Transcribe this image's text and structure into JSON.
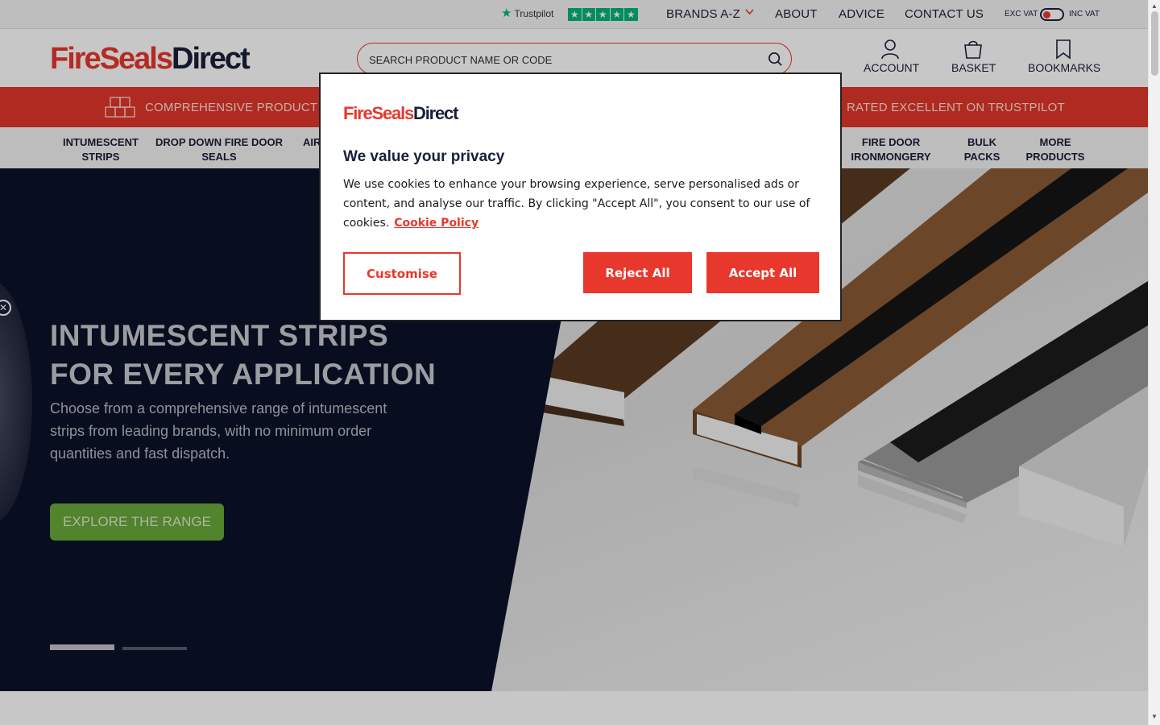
{
  "topbar": {
    "trustpilot_label": "Trustpilot",
    "trustpilot_stars": 5,
    "links": [
      "BRANDS A-Z",
      "ABOUT",
      "ADVICE",
      "CONTACT US"
    ],
    "vat_exc": "EXC VAT",
    "vat_inc": "INC VAT"
  },
  "header": {
    "logo_part1": "FireSeals",
    "logo_part2": "Direct",
    "search_placeholder": "SEARCH PRODUCT NAME OR CODE",
    "account": "ACCOUNT",
    "basket": "BASKET",
    "bookmarks": "BOOKMARKS"
  },
  "banner": {
    "left_text": "COMPREHENSIVE PRODUCT RA",
    "right_text": "RATED EXCELLENT ON TRUSTPILOT"
  },
  "categories": [
    {
      "line1": "INTUMESCENT",
      "line2": "STRIPS"
    },
    {
      "line1": "DROP DOWN FIRE DOOR",
      "line2": "SEALS"
    },
    {
      "line1": "AIR",
      "line2": ""
    },
    {
      "line1": "FIRE DOOR",
      "line2": "IRONMONGERY"
    },
    {
      "line1": "BULK",
      "line2": "PACKS"
    },
    {
      "line1": "MORE",
      "line2": "PRODUCTS"
    }
  ],
  "hero": {
    "title_line1": "INTUMESCENT STRIPS",
    "title_line2": "FOR EVERY APPLICATION",
    "subtitle": "Choose from a comprehensive range of intumescent strips from leading brands, with no minimum order quantities and fast dispatch.",
    "cta": "EXPLORE THE RANGE",
    "slides_total": 2,
    "slide_active": 1
  },
  "modal": {
    "logo_part1": "FireSeals",
    "logo_part2": "Direct",
    "title": "We value your privacy",
    "text": "We use cookies to enhance your browsing experience, serve personalised ads or content, and analyse our traffic. By clicking \"Accept All\", you consent to our use of cookies.",
    "policy_link": "Cookie Policy",
    "customise": "Customise",
    "reject": "Reject All",
    "accept": "Accept All"
  },
  "colors": {
    "brand_red": "#e8382d",
    "navy": "#1a1f3a",
    "hero_dark": "#0b1128",
    "cta_green": "#6aa83a",
    "trustpilot_green": "#00b67a"
  }
}
